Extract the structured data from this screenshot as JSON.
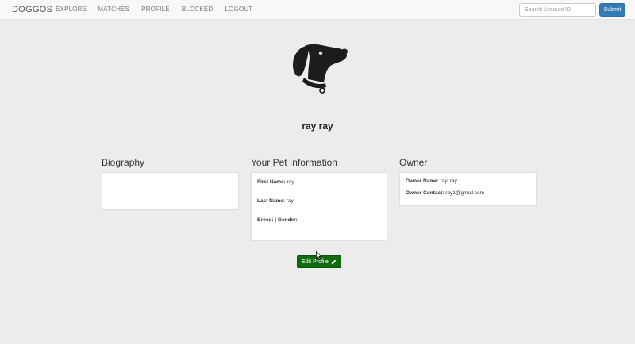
{
  "navbar": {
    "brand": "DOGGOS",
    "links": [
      "EXPLORE",
      "MATCHES",
      "PROFILE",
      "BLOCKED",
      "LOGOUT"
    ],
    "search_placeholder": "Search Account ID",
    "submit_label": "Submit"
  },
  "profile": {
    "avatar_icon": "dog-head-icon",
    "name": "ray ray"
  },
  "biography": {
    "title": "Biography",
    "text": ""
  },
  "pet_info": {
    "title": "Your Pet Information",
    "first_name_label": "First Name:",
    "first_name": "ray",
    "last_name_label": "Last Name:",
    "last_name": "ray",
    "breed_label": "Breed:",
    "breed_value": "|",
    "gender_label": "Gender:",
    "gender_value": ""
  },
  "owner": {
    "title": "Owner",
    "name_label": "Owner Name:",
    "name": "ray, ray",
    "contact_label": "Owner Contact:",
    "contact": "ray1@gmail.com"
  },
  "actions": {
    "edit_label": "Edit Profile",
    "edit_icon": "pencil-icon",
    "edit_color": "#0f6b0f"
  }
}
